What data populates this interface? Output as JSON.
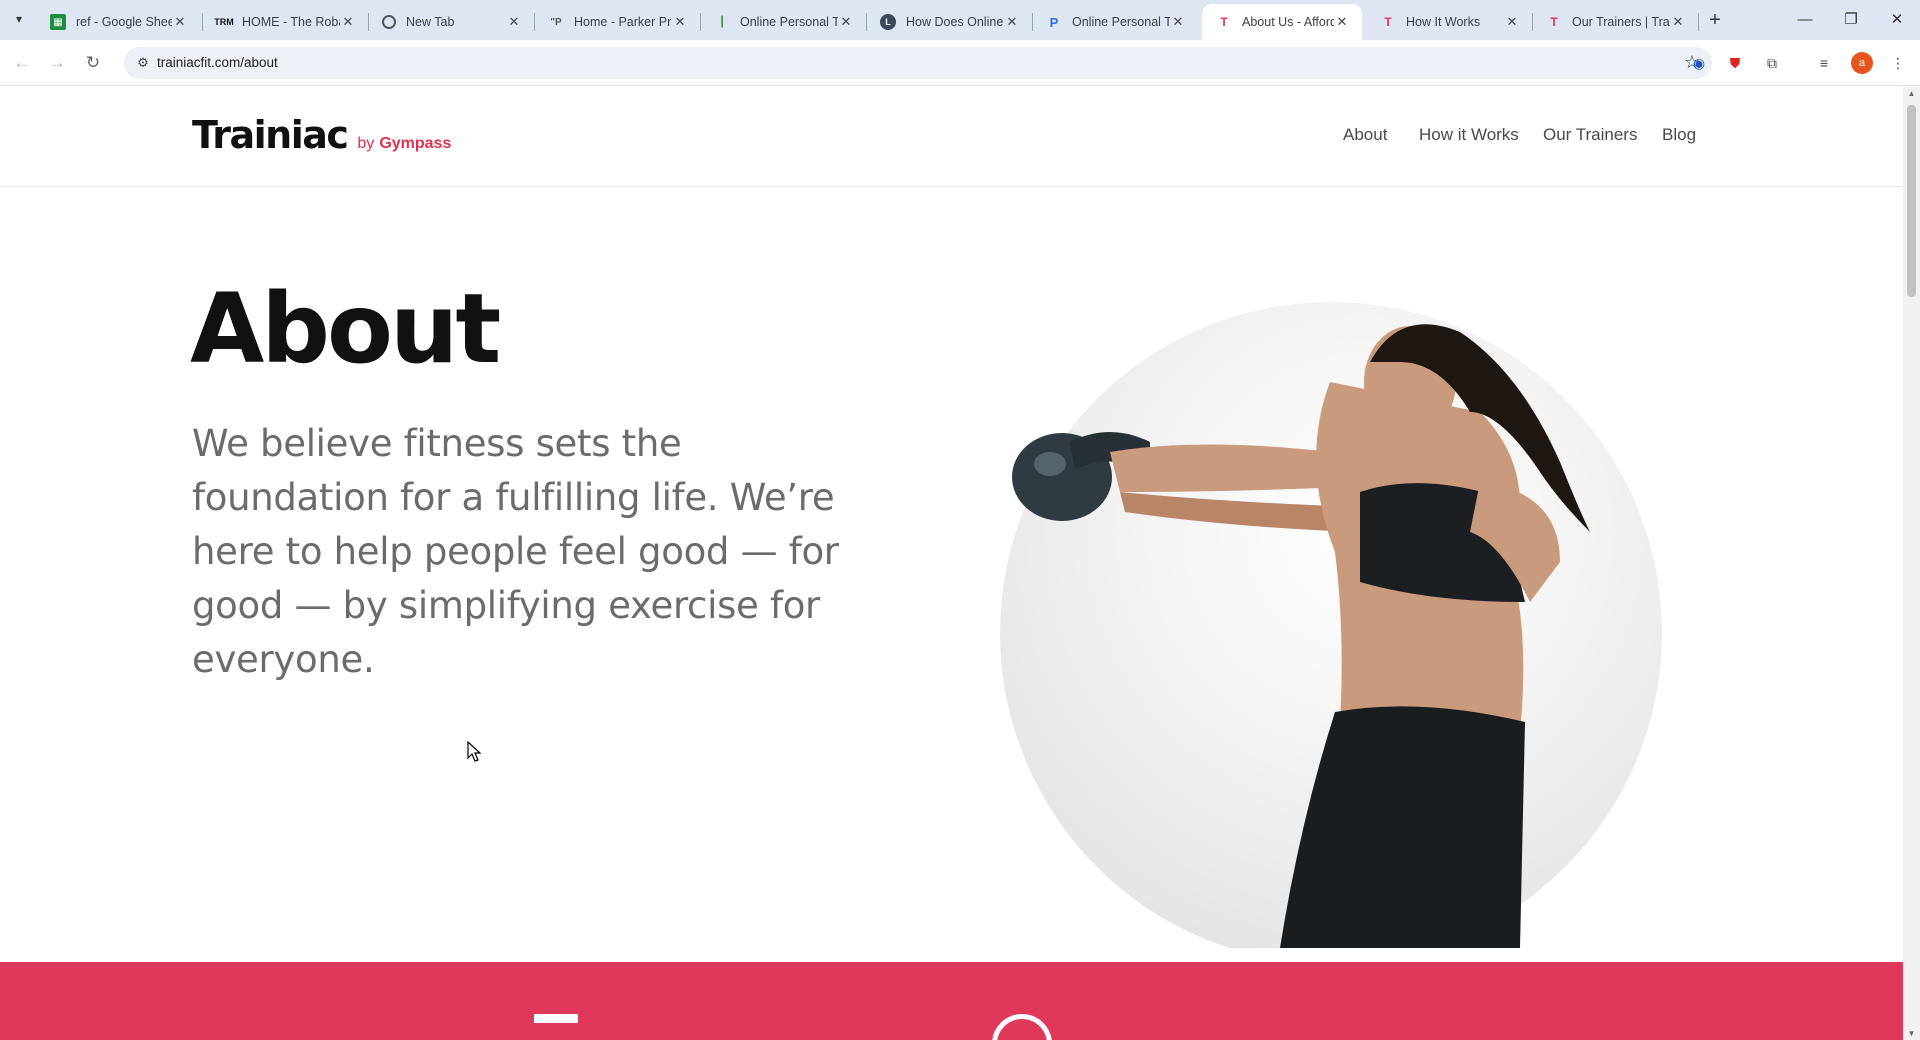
{
  "browser": {
    "tabs": [
      {
        "title": "ref - Google Sheets",
        "favicon": "sheets-icon",
        "active": false
      },
      {
        "title": "HOME - The Robar",
        "favicon": "trm-icon",
        "active": false
      },
      {
        "title": "New Tab",
        "favicon": "chrome-icon",
        "active": false
      },
      {
        "title": "Home - Parker Pr",
        "favicon": "pp-icon",
        "active": false
      },
      {
        "title": "Online Personal Tr",
        "favicon": "trainer-icon",
        "active": false
      },
      {
        "title": "How Does Online",
        "favicon": "clock-icon",
        "active": false
      },
      {
        "title": "Online Personal Tr",
        "favicon": "p-icon",
        "active": false
      },
      {
        "title": "About Us - Afford",
        "favicon": "trainiac-icon",
        "active": true
      },
      {
        "title": "How It Works",
        "favicon": "trainiac-icon",
        "active": false
      },
      {
        "title": "Our Trainers | Trai",
        "favicon": "trainiac-icon",
        "active": false
      }
    ],
    "url": "trainiacfit.com/about",
    "profile_initial": "a"
  },
  "site": {
    "logo_main": "Trainiac",
    "logo_by": "by",
    "logo_brand": "Gympass",
    "menu": [
      "About",
      "How it Works",
      "Our Trainers",
      "Blog"
    ]
  },
  "hero": {
    "title": "About",
    "text": "We believe fitness sets the foundation for a fulfilling life. We’re here to help people feel good — for good — by simplifying exercise for everyone."
  },
  "colors": {
    "accent": "#e0385a",
    "heading": "#111111",
    "body_text": "#6b6b6b"
  }
}
